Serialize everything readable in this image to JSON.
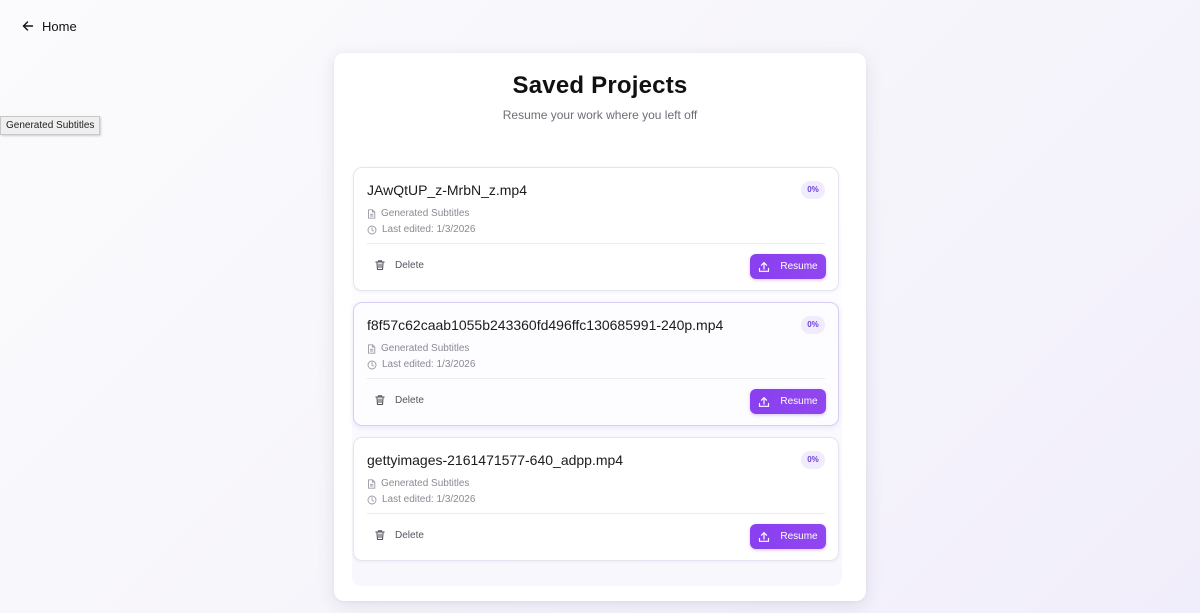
{
  "nav": {
    "home_label": "Home",
    "back_icon": "arrow-left-icon"
  },
  "tooltip": {
    "text": "Generated Subtitles"
  },
  "page": {
    "title": "Saved Projects",
    "subtitle": "Resume your work where you left off"
  },
  "projects": [
    {
      "name": "JAwQtUP_z-MrbN_z.mp4",
      "progress": "0%",
      "type": "Generated Subtitles",
      "last_edited": "Last edited: 1/3/2026",
      "delete_label": "Delete",
      "resume_label": "Resume"
    },
    {
      "name": "f8f57c62caab1055b243360fd496ffc130685991-240p.mp4",
      "progress": "0%",
      "type": "Generated Subtitles",
      "last_edited": "Last edited: 1/3/2026",
      "delete_label": "Delete",
      "resume_label": "Resume"
    },
    {
      "name": "gettyimages-2161471577-640_adpp.mp4",
      "progress": "0%",
      "type": "Generated Subtitles",
      "last_edited": "Last edited: 1/3/2026",
      "delete_label": "Delete",
      "resume_label": "Resume"
    }
  ],
  "colors": {
    "accent": "#8b41f0",
    "badge_bg": "#f0ebfd",
    "badge_text": "#6b3fd8"
  },
  "icons": {
    "file": "file-icon",
    "clock": "clock-icon",
    "trash": "trash-icon",
    "upload": "upload-icon"
  }
}
